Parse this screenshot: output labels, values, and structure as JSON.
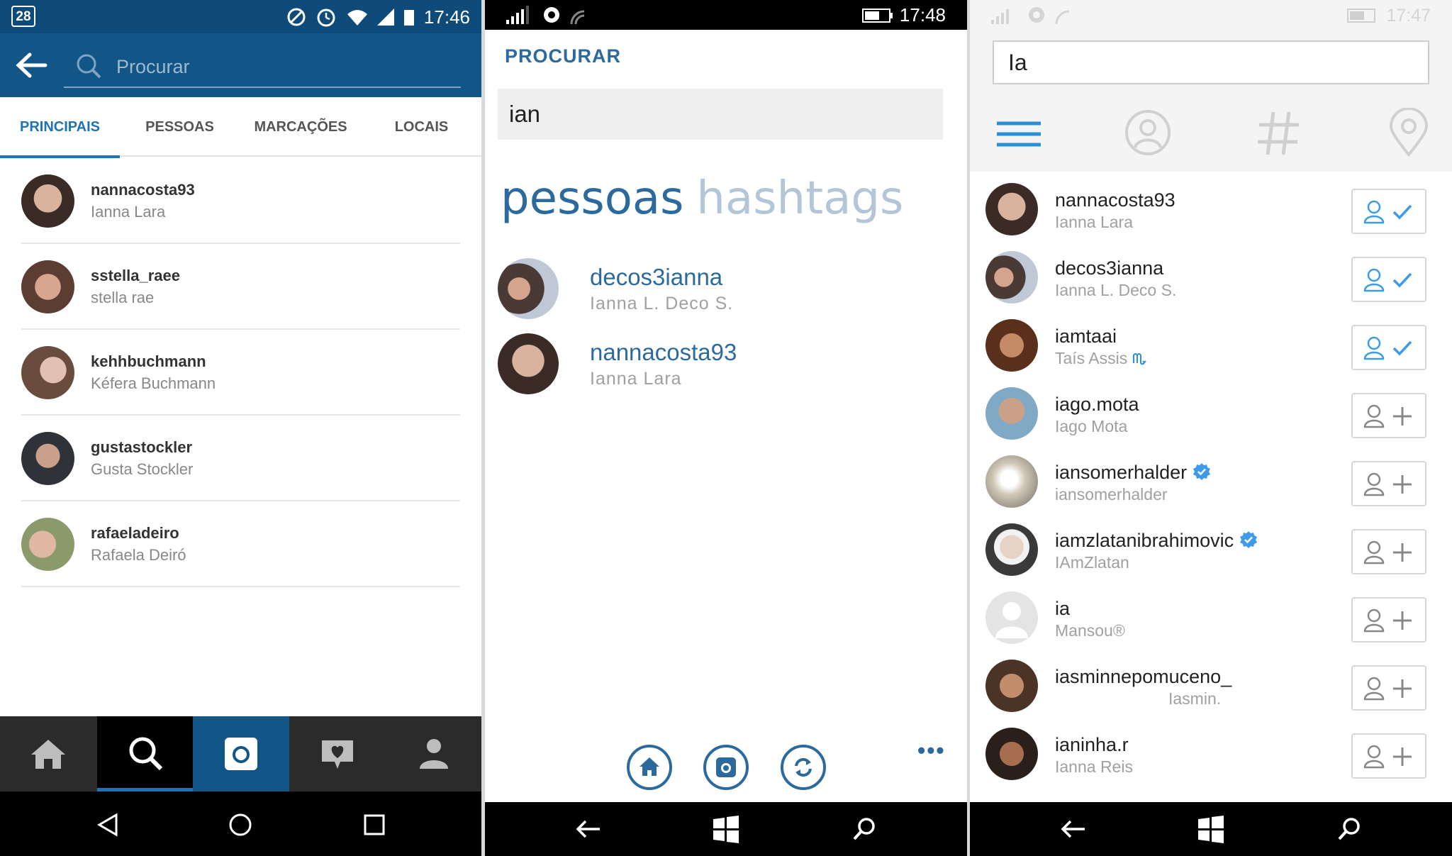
{
  "colors": {
    "android_blue": "#125688",
    "android_accent": "#1f72b5",
    "wp_blue": "#2c6a9e",
    "check_blue": "#3d9be9"
  },
  "panel1": {
    "status": {
      "calendar_day": "28",
      "time": "17:46"
    },
    "search": {
      "placeholder": "Procurar"
    },
    "tabs": [
      {
        "label": "PRINCIPAIS",
        "active": true
      },
      {
        "label": "PESSOAS",
        "active": false
      },
      {
        "label": "MARCAÇÕES",
        "active": false
      },
      {
        "label": "LOCAIS",
        "active": false
      }
    ],
    "results": [
      {
        "username": "nannacosta93",
        "name": "Ianna Lara"
      },
      {
        "username": "sstella_raee",
        "name": "stella rae"
      },
      {
        "username": "kehhbuchmann",
        "name": "Kéfera Buchmann"
      },
      {
        "username": "gustastockler",
        "name": "Gusta Stockler"
      },
      {
        "username": "rafaeladeiro",
        "name": "Rafaela Deiró"
      }
    ],
    "nav": [
      "home-icon",
      "search-icon",
      "camera-icon",
      "activity-icon",
      "profile-icon"
    ]
  },
  "panel2": {
    "status": {
      "time": "17:48"
    },
    "title": "PROCURAR",
    "search": {
      "value": "ian"
    },
    "pivots": {
      "active": "pessoas",
      "inactive": "hashtags"
    },
    "results": [
      {
        "username": "decos3ianna",
        "name": "Ianna L. Deco S."
      },
      {
        "username": "nannacosta93",
        "name": "Ianna Lara"
      }
    ],
    "more": "•••"
  },
  "panel3": {
    "status": {
      "time": "17:47"
    },
    "search": {
      "value": "Ia"
    },
    "results": [
      {
        "username": "nannacosta93",
        "name": "Ianna Lara",
        "following": true
      },
      {
        "username": "decos3ianna",
        "name": "Ianna L. Deco S.",
        "following": true
      },
      {
        "username": "iamtaai",
        "name": "Taís Assis",
        "following": true
      },
      {
        "username": "iago.mota",
        "name": "Iago Mota",
        "following": false
      },
      {
        "username": "iansomerhalder",
        "name": "iansomerhalder",
        "following": false,
        "verified": true
      },
      {
        "username": "iamzlatanibrahimovic",
        "name": "IAmZlatan",
        "following": false,
        "verified": true
      },
      {
        "username": "ia",
        "name": "Mansou®",
        "following": false
      },
      {
        "username": "iasminnepomuceno_",
        "name": "Iasmin.",
        "following": false
      },
      {
        "username": "ianinha.r",
        "name": "Ianna Reis",
        "following": false
      }
    ]
  }
}
